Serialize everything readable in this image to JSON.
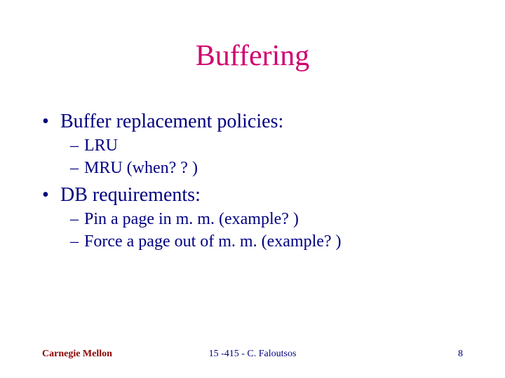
{
  "title": "Buffering",
  "items": [
    {
      "level": 1,
      "text": "Buffer replacement policies:"
    },
    {
      "level": 2,
      "text": "LRU"
    },
    {
      "level": 2,
      "text": "MRU (when? ? )"
    },
    {
      "level": 1,
      "text": "DB requirements:"
    },
    {
      "level": 2,
      "text": "Pin a page in m. m. (example? )"
    },
    {
      "level": 2,
      "text": "Force a page out of m. m. (example? )"
    }
  ],
  "footer": {
    "left": "Carnegie Mellon",
    "center": "15 -415 - C. Faloutsos",
    "right": "8"
  }
}
